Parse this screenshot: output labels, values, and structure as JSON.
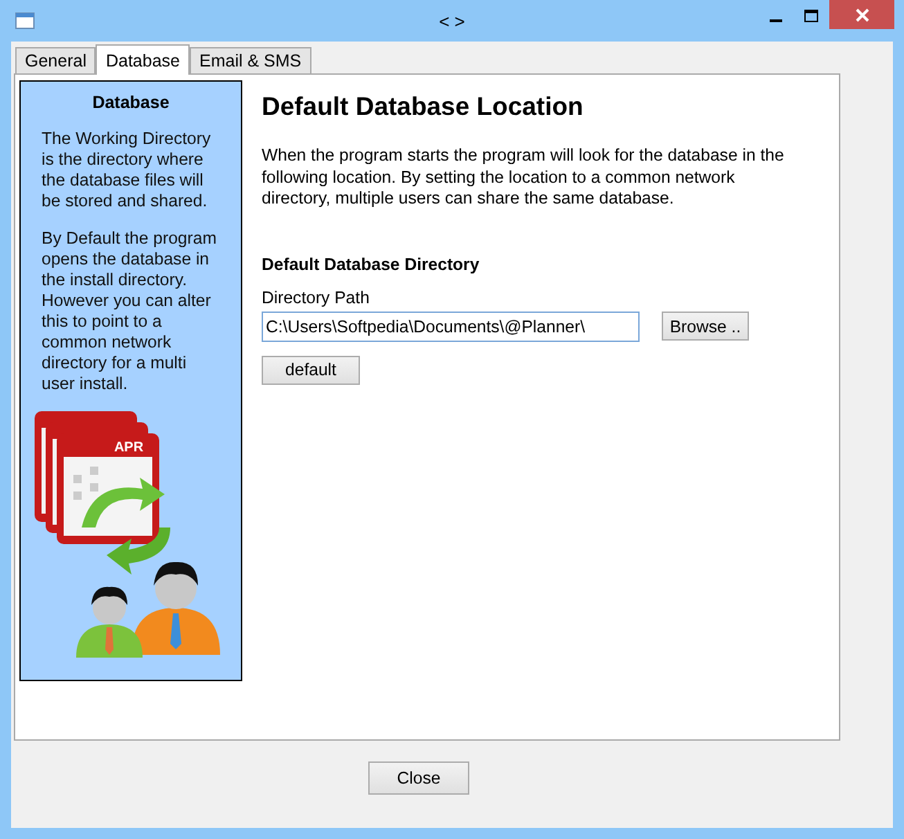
{
  "window": {
    "title": "< >"
  },
  "tabs": [
    {
      "label": "General",
      "selected": false
    },
    {
      "label": "Database",
      "selected": true
    },
    {
      "label": "Email & SMS",
      "selected": false
    }
  ],
  "sidebar": {
    "title": "Database",
    "paragraphs": [
      "The Working Directory is the directory where the database files will be stored and shared.",
      "By Default the program opens the database in the install directory. However you can alter this to point to a common network directory for a multi user install."
    ],
    "calendar_label": "APR"
  },
  "main": {
    "heading": "Default Database Location",
    "description": "When the program starts the program will look for the database in the following location. By setting the location to a common network directory, multiple users can share the same database.",
    "section_title": "Default Database Directory",
    "field_label": "Directory Path",
    "path_value": "C:\\Users\\Softpedia\\Documents\\@Planner\\",
    "browse_button": "Browse ..",
    "default_button": "default"
  },
  "footer": {
    "close_button": "Close"
  }
}
